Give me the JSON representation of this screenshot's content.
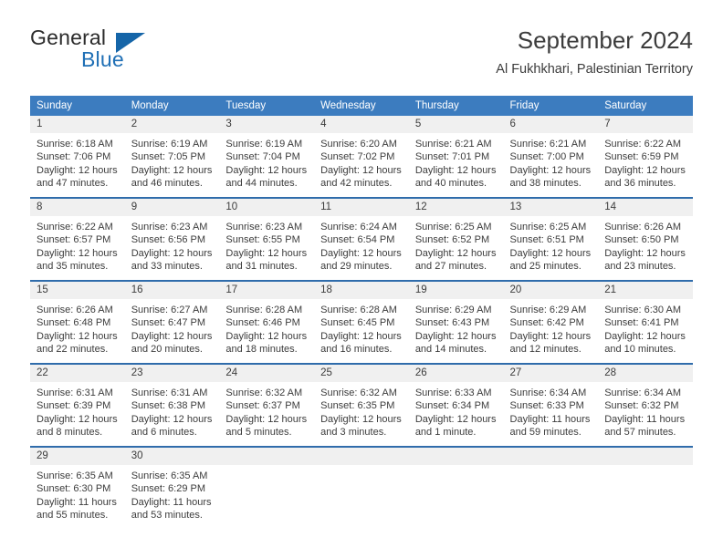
{
  "brand": {
    "name_top": "General",
    "name_bottom": "Blue",
    "accent_color": "#1565a8"
  },
  "header": {
    "title": "September 2024",
    "subtitle": "Al Fukhkhari, Palestinian Territory"
  },
  "theme": {
    "header_row_bg": "#3c7cbf",
    "row_separator": "#2f6cab",
    "daynum_bg": "#f0f0f0",
    "text": "#3c3c3c"
  },
  "calendar": {
    "weekday_headers": [
      "Sunday",
      "Monday",
      "Tuesday",
      "Wednesday",
      "Thursday",
      "Friday",
      "Saturday"
    ],
    "weeks": [
      [
        {
          "day": "1",
          "sunrise": "Sunrise: 6:18 AM",
          "sunset": "Sunset: 7:06 PM",
          "daylight_1": "Daylight: 12 hours",
          "daylight_2": "and 47 minutes."
        },
        {
          "day": "2",
          "sunrise": "Sunrise: 6:19 AM",
          "sunset": "Sunset: 7:05 PM",
          "daylight_1": "Daylight: 12 hours",
          "daylight_2": "and 46 minutes."
        },
        {
          "day": "3",
          "sunrise": "Sunrise: 6:19 AM",
          "sunset": "Sunset: 7:04 PM",
          "daylight_1": "Daylight: 12 hours",
          "daylight_2": "and 44 minutes."
        },
        {
          "day": "4",
          "sunrise": "Sunrise: 6:20 AM",
          "sunset": "Sunset: 7:02 PM",
          "daylight_1": "Daylight: 12 hours",
          "daylight_2": "and 42 minutes."
        },
        {
          "day": "5",
          "sunrise": "Sunrise: 6:21 AM",
          "sunset": "Sunset: 7:01 PM",
          "daylight_1": "Daylight: 12 hours",
          "daylight_2": "and 40 minutes."
        },
        {
          "day": "6",
          "sunrise": "Sunrise: 6:21 AM",
          "sunset": "Sunset: 7:00 PM",
          "daylight_1": "Daylight: 12 hours",
          "daylight_2": "and 38 minutes."
        },
        {
          "day": "7",
          "sunrise": "Sunrise: 6:22 AM",
          "sunset": "Sunset: 6:59 PM",
          "daylight_1": "Daylight: 12 hours",
          "daylight_2": "and 36 minutes."
        }
      ],
      [
        {
          "day": "8",
          "sunrise": "Sunrise: 6:22 AM",
          "sunset": "Sunset: 6:57 PM",
          "daylight_1": "Daylight: 12 hours",
          "daylight_2": "and 35 minutes."
        },
        {
          "day": "9",
          "sunrise": "Sunrise: 6:23 AM",
          "sunset": "Sunset: 6:56 PM",
          "daylight_1": "Daylight: 12 hours",
          "daylight_2": "and 33 minutes."
        },
        {
          "day": "10",
          "sunrise": "Sunrise: 6:23 AM",
          "sunset": "Sunset: 6:55 PM",
          "daylight_1": "Daylight: 12 hours",
          "daylight_2": "and 31 minutes."
        },
        {
          "day": "11",
          "sunrise": "Sunrise: 6:24 AM",
          "sunset": "Sunset: 6:54 PM",
          "daylight_1": "Daylight: 12 hours",
          "daylight_2": "and 29 minutes."
        },
        {
          "day": "12",
          "sunrise": "Sunrise: 6:25 AM",
          "sunset": "Sunset: 6:52 PM",
          "daylight_1": "Daylight: 12 hours",
          "daylight_2": "and 27 minutes."
        },
        {
          "day": "13",
          "sunrise": "Sunrise: 6:25 AM",
          "sunset": "Sunset: 6:51 PM",
          "daylight_1": "Daylight: 12 hours",
          "daylight_2": "and 25 minutes."
        },
        {
          "day": "14",
          "sunrise": "Sunrise: 6:26 AM",
          "sunset": "Sunset: 6:50 PM",
          "daylight_1": "Daylight: 12 hours",
          "daylight_2": "and 23 minutes."
        }
      ],
      [
        {
          "day": "15",
          "sunrise": "Sunrise: 6:26 AM",
          "sunset": "Sunset: 6:48 PM",
          "daylight_1": "Daylight: 12 hours",
          "daylight_2": "and 22 minutes."
        },
        {
          "day": "16",
          "sunrise": "Sunrise: 6:27 AM",
          "sunset": "Sunset: 6:47 PM",
          "daylight_1": "Daylight: 12 hours",
          "daylight_2": "and 20 minutes."
        },
        {
          "day": "17",
          "sunrise": "Sunrise: 6:28 AM",
          "sunset": "Sunset: 6:46 PM",
          "daylight_1": "Daylight: 12 hours",
          "daylight_2": "and 18 minutes."
        },
        {
          "day": "18",
          "sunrise": "Sunrise: 6:28 AM",
          "sunset": "Sunset: 6:45 PM",
          "daylight_1": "Daylight: 12 hours",
          "daylight_2": "and 16 minutes."
        },
        {
          "day": "19",
          "sunrise": "Sunrise: 6:29 AM",
          "sunset": "Sunset: 6:43 PM",
          "daylight_1": "Daylight: 12 hours",
          "daylight_2": "and 14 minutes."
        },
        {
          "day": "20",
          "sunrise": "Sunrise: 6:29 AM",
          "sunset": "Sunset: 6:42 PM",
          "daylight_1": "Daylight: 12 hours",
          "daylight_2": "and 12 minutes."
        },
        {
          "day": "21",
          "sunrise": "Sunrise: 6:30 AM",
          "sunset": "Sunset: 6:41 PM",
          "daylight_1": "Daylight: 12 hours",
          "daylight_2": "and 10 minutes."
        }
      ],
      [
        {
          "day": "22",
          "sunrise": "Sunrise: 6:31 AM",
          "sunset": "Sunset: 6:39 PM",
          "daylight_1": "Daylight: 12 hours",
          "daylight_2": "and 8 minutes."
        },
        {
          "day": "23",
          "sunrise": "Sunrise: 6:31 AM",
          "sunset": "Sunset: 6:38 PM",
          "daylight_1": "Daylight: 12 hours",
          "daylight_2": "and 6 minutes."
        },
        {
          "day": "24",
          "sunrise": "Sunrise: 6:32 AM",
          "sunset": "Sunset: 6:37 PM",
          "daylight_1": "Daylight: 12 hours",
          "daylight_2": "and 5 minutes."
        },
        {
          "day": "25",
          "sunrise": "Sunrise: 6:32 AM",
          "sunset": "Sunset: 6:35 PM",
          "daylight_1": "Daylight: 12 hours",
          "daylight_2": "and 3 minutes."
        },
        {
          "day": "26",
          "sunrise": "Sunrise: 6:33 AM",
          "sunset": "Sunset: 6:34 PM",
          "daylight_1": "Daylight: 12 hours",
          "daylight_2": "and 1 minute."
        },
        {
          "day": "27",
          "sunrise": "Sunrise: 6:34 AM",
          "sunset": "Sunset: 6:33 PM",
          "daylight_1": "Daylight: 11 hours",
          "daylight_2": "and 59 minutes."
        },
        {
          "day": "28",
          "sunrise": "Sunrise: 6:34 AM",
          "sunset": "Sunset: 6:32 PM",
          "daylight_1": "Daylight: 11 hours",
          "daylight_2": "and 57 minutes."
        }
      ],
      [
        {
          "day": "29",
          "sunrise": "Sunrise: 6:35 AM",
          "sunset": "Sunset: 6:30 PM",
          "daylight_1": "Daylight: 11 hours",
          "daylight_2": "and 55 minutes."
        },
        {
          "day": "30",
          "sunrise": "Sunrise: 6:35 AM",
          "sunset": "Sunset: 6:29 PM",
          "daylight_1": "Daylight: 11 hours",
          "daylight_2": "and 53 minutes."
        },
        {
          "day": "",
          "sunrise": "",
          "sunset": "",
          "daylight_1": "",
          "daylight_2": ""
        },
        {
          "day": "",
          "sunrise": "",
          "sunset": "",
          "daylight_1": "",
          "daylight_2": ""
        },
        {
          "day": "",
          "sunrise": "",
          "sunset": "",
          "daylight_1": "",
          "daylight_2": ""
        },
        {
          "day": "",
          "sunrise": "",
          "sunset": "",
          "daylight_1": "",
          "daylight_2": ""
        },
        {
          "day": "",
          "sunrise": "",
          "sunset": "",
          "daylight_1": "",
          "daylight_2": ""
        }
      ]
    ]
  }
}
